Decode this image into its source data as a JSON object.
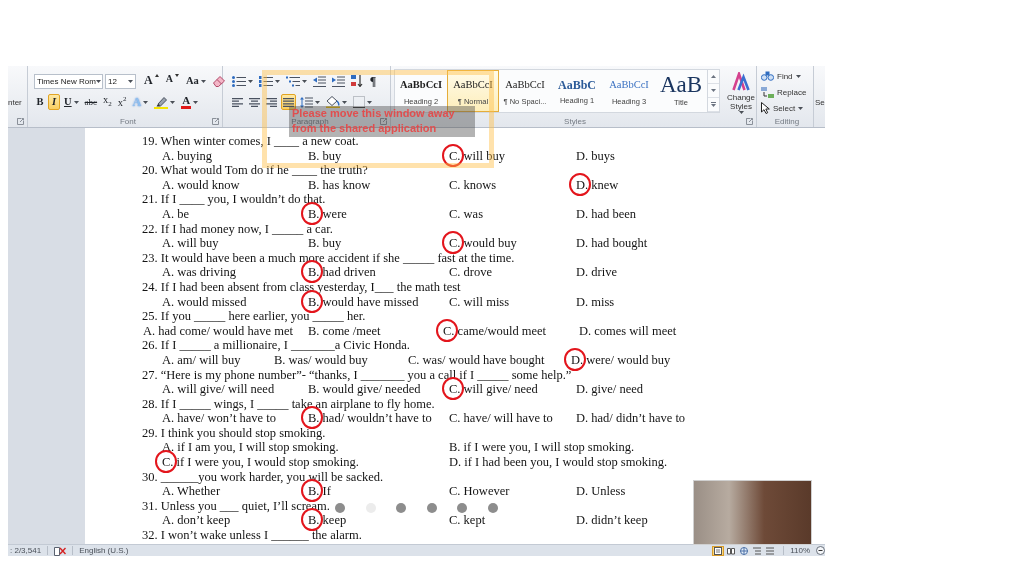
{
  "ribbon": {
    "clipboard": {
      "cut_label": "nter"
    },
    "font": {
      "font_name": "Times New Rom",
      "font_size": "12",
      "row1": [
        {
          "kind": "grow",
          "label": "A"
        },
        {
          "kind": "shrink",
          "label": "A"
        },
        {
          "kind": "case",
          "label": "Aa"
        },
        {
          "kind": "clear"
        }
      ],
      "row2": [
        {
          "kind": "bold",
          "label": "B",
          "selected": false
        },
        {
          "kind": "italic",
          "label": "I",
          "selected": true
        },
        {
          "kind": "underline",
          "label": "U",
          "selected": false
        },
        {
          "kind": "strike",
          "label": "abc",
          "selected": false
        },
        {
          "kind": "subscript",
          "label": "x$_{2}$",
          "selected": false
        },
        {
          "kind": "superscript",
          "label": "x$^{2}$",
          "selected": false
        },
        {
          "kind": "effects",
          "label": "A",
          "selected": false
        },
        {
          "kind": "highlight",
          "selected": false
        },
        {
          "kind": "color",
          "label": "A",
          "selected": false
        }
      ],
      "label": "Font"
    },
    "paragraph": {
      "row1": [
        {
          "kind": "bullets",
          "selected": false
        },
        {
          "kind": "numbering",
          "selected": false
        },
        {
          "kind": "multilevel",
          "selected": false
        },
        {
          "kind": "outdent",
          "selected": false
        },
        {
          "kind": "indent",
          "selected": false
        },
        {
          "kind": "sort",
          "selected": false
        },
        {
          "kind": "pilcrow",
          "label": "¶",
          "selected": false
        }
      ],
      "row2": [
        {
          "kind": "align_left",
          "selected": false
        },
        {
          "kind": "align_center",
          "selected": false
        },
        {
          "kind": "align_right",
          "selected": false
        },
        {
          "kind": "justify",
          "selected": true
        },
        {
          "kind": "line_spacing",
          "selected": false
        },
        {
          "kind": "shading",
          "selected": false
        },
        {
          "kind": "borders",
          "selected": false
        }
      ],
      "label": "Paragraph"
    },
    "styles": {
      "items": [
        {
          "kind": "heading2",
          "preview": "AaBbCcI",
          "name": "Heading 2",
          "selected": false
        },
        {
          "kind": "normal",
          "preview": "AaBbCcI",
          "name": "¶ Normal",
          "selected": true
        },
        {
          "kind": "nospacing",
          "preview": "AaBbCcI",
          "name": "¶ No Spaci...",
          "selected": false
        },
        {
          "kind": "heading1",
          "preview": "AaBbC",
          "name": "Heading 1",
          "selected": false
        },
        {
          "kind": "heading3",
          "preview": "AaBbCcI",
          "name": "Heading 3",
          "selected": false
        },
        {
          "kind": "title",
          "preview": "AaB",
          "name": "Title",
          "selected": false
        }
      ],
      "change_styles": "Change Styles",
      "label": "Styles"
    },
    "editing": {
      "items": [
        {
          "kind": "find",
          "label": "Find",
          "menu": true
        },
        {
          "kind": "replace",
          "label": "Replace",
          "menu": false
        },
        {
          "kind": "select",
          "label": "Select",
          "menu": true
        }
      ],
      "label": "Editing"
    },
    "next_group_cut": "Se"
  },
  "share_warning": "Please move this window away from the shared application",
  "document": {
    "questions": [
      {
        "text": "19. When winter comes, I ____ a new coat.",
        "kind": "four",
        "options": [
          {
            "text": "A. buying",
            "circled": false
          },
          {
            "text": "B. buy",
            "circled": false
          },
          {
            "text": "C. will buy",
            "circled": true
          },
          {
            "text": "D. buys",
            "circled": false
          }
        ]
      },
      {
        "text": "20. What would Tom do if he ____ the truth?",
        "kind": "four",
        "options": [
          {
            "text": "A. would know",
            "circled": false
          },
          {
            "text": "B. has know",
            "circled": false
          },
          {
            "text": "C. knows",
            "circled": false
          },
          {
            "text": "D. knew",
            "circled": true
          }
        ]
      },
      {
        "text": "21. If I ____ you, I wouldn’t do that.",
        "kind": "four",
        "options": [
          {
            "text": "A. be",
            "circled": false
          },
          {
            "text": "B. were",
            "circled": true
          },
          {
            "text": "C. was",
            "circled": false
          },
          {
            "text": "D. had been",
            "circled": false
          }
        ]
      },
      {
        "text": "22. If I had money now, I _____ a car.",
        "kind": "four",
        "options": [
          {
            "text": "A. will buy",
            "circled": false
          },
          {
            "text": "B. buy",
            "circled": false
          },
          {
            "text": "C. would buy",
            "circled": true
          },
          {
            "text": "D. had bought",
            "circled": false
          }
        ]
      },
      {
        "text": "23. It would have been a much more accident if she _____ fast at the time.",
        "kind": "four",
        "options": [
          {
            "text": "A. was driving",
            "circled": false
          },
          {
            "text": "B. had driven",
            "circled": true
          },
          {
            "text": "C. drove",
            "circled": false
          },
          {
            "text": "D. drive",
            "circled": false
          }
        ]
      },
      {
        "text": "24. If I had been absent from class yesterday, I___ the math test",
        "kind": "four",
        "options": [
          {
            "text": "A. would missed",
            "circled": false
          },
          {
            "text": "B. would have missed",
            "circled": true
          },
          {
            "text": "C. will miss",
            "circled": false
          },
          {
            "text": "D. miss",
            "circled": false
          }
        ]
      },
      {
        "text": "25. If you _____ here earlier, you _____ her.",
        "kind": "four_flush",
        "options": [
          {
            "text": "A. had come/ would have met",
            "circled": false
          },
          {
            "text": "B. come /meet",
            "circled": false
          },
          {
            "text": "C. came/would meet",
            "circled": true
          },
          {
            "text": "D. comes will meet",
            "circled": false
          }
        ]
      },
      {
        "text": "26. If I _____ a millionaire, I _______a Civic Honda.",
        "kind": "four_narrow",
        "options": [
          {
            "text": "A. am/ will buy",
            "circled": false
          },
          {
            "text": "B. was/ would buy",
            "circled": false
          },
          {
            "text": "C. was/ would have bought",
            "circled": false
          },
          {
            "text": "D. were/ would buy",
            "circled": true
          }
        ]
      },
      {
        "text": "27. “Here is my phone number”- “thanks, I _______ you a call if I _____ some help.”",
        "kind": "four",
        "options": [
          {
            "text": "A. will give/ will need",
            "circled": false
          },
          {
            "text": "B. would give/ needed",
            "circled": false
          },
          {
            "text": "C. will give/ need",
            "circled": true
          },
          {
            "text": "D. give/ need",
            "circled": false
          }
        ]
      },
      {
        "text": "28. If I _____ wings, I _____ take an airplane to fly home.",
        "kind": "four",
        "options": [
          {
            "text": "A. have/ won’t have to",
            "circled": false
          },
          {
            "text": "B. had/ wouldn’t have to",
            "circled": true
          },
          {
            "text": "C. have/ will have to",
            "circled": false
          },
          {
            "text": "D. had/ didn’t have to",
            "circled": false
          }
        ]
      },
      {
        "text": "29. I think you should stop smoking.",
        "kind": "two",
        "options": [
          {
            "text": "A. if I am you, I will stop smoking.",
            "circled": false
          },
          {
            "text": "B. if I were you, I will stop smoking.",
            "circled": false
          },
          {
            "text": "C. if I were you, I would stop smoking.",
            "circled": true
          },
          {
            "text": "D. if I had been you, I would stop smoking.",
            "circled": false
          }
        ]
      },
      {
        "text": "30. ______you work harder, you will be sacked.",
        "kind": "four",
        "options": [
          {
            "text": "A. Whether",
            "circled": false
          },
          {
            "text": "B. If",
            "circled": true
          },
          {
            "text": "C. However",
            "circled": false
          },
          {
            "text": "D. Unless",
            "circled": false
          }
        ]
      },
      {
        "text": "31. Unless you ___ quiet, I’ll scream.",
        "kind": "four",
        "options": [
          {
            "text": "A. don’t keep",
            "circled": false
          },
          {
            "text": "B. keep",
            "circled": true
          },
          {
            "text": "C. kept",
            "circled": false
          },
          {
            "text": "D. didn’t keep",
            "circled": false
          }
        ]
      },
      {
        "text": "32. I won’t wake unless I ______ the alarm.",
        "kind": "four"
      }
    ]
  },
  "pager_dots": [
    {
      "selected": false
    },
    {
      "selected": true
    },
    {
      "selected": false
    },
    {
      "selected": false
    },
    {
      "selected": false
    },
    {
      "selected": false
    }
  ],
  "status_bar": {
    "words": ": 2/3,541",
    "language": "English (U.S.)",
    "views": [
      {
        "kind": "print",
        "selected": true
      },
      {
        "kind": "reading",
        "selected": false
      },
      {
        "kind": "web",
        "selected": false
      },
      {
        "kind": "outline",
        "selected": false
      },
      {
        "kind": "draft",
        "selected": false
      }
    ],
    "zoom": "110%"
  }
}
